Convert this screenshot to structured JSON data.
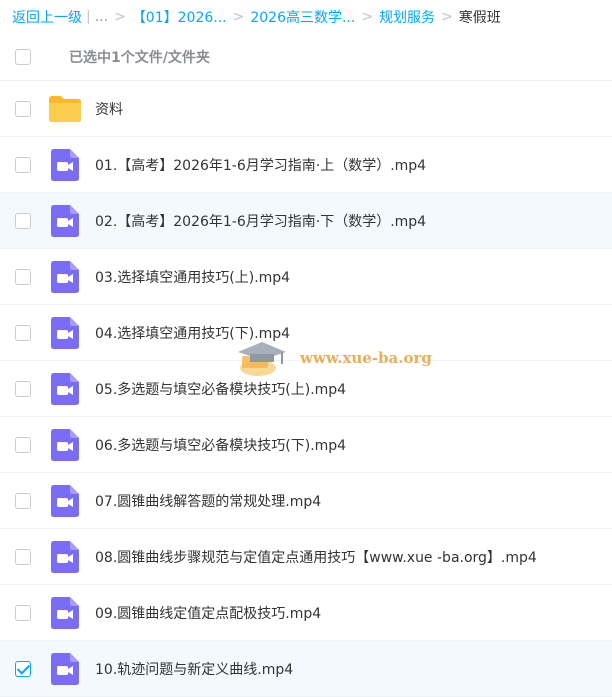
{
  "breadcrumb": {
    "back_label": "返回上一级",
    "ellipsis": "...",
    "crumbs": [
      "【01】2026...",
      "2026高三数学...",
      "规划服务"
    ],
    "current": "寒假班"
  },
  "header": {
    "selected_text": "已选中1个文件/文件夹"
  },
  "files": [
    {
      "name": "资料",
      "type": "folder",
      "checked": false
    },
    {
      "name": "01.【高考】2026年1-6月学习指南·上（数学）.mp4",
      "type": "video",
      "checked": false
    },
    {
      "name": "02.【高考】2026年1-6月学习指南·下（数学）.mp4",
      "type": "video",
      "checked": false
    },
    {
      "name": "03.选择填空通用技巧(上).mp4",
      "type": "video",
      "checked": false
    },
    {
      "name": "04.选择填空通用技巧(下).mp4",
      "type": "video",
      "checked": false
    },
    {
      "name": "05.多选题与填空必备模块技巧(上).mp4",
      "type": "video",
      "checked": false
    },
    {
      "name": "06.多选题与填空必备模块技巧(下).mp4",
      "type": "video",
      "checked": false
    },
    {
      "name": "07.圆锥曲线解答题的常规处理.mp4",
      "type": "video",
      "checked": false
    },
    {
      "name": "08.圆锥曲线步骤规范与定值定点通用技巧【www.xue -ba.org】.mp4",
      "type": "video",
      "checked": false
    },
    {
      "name": "09.圆锥曲线定值定点配极技巧.mp4",
      "type": "video",
      "checked": false
    },
    {
      "name": "10.轨迹问题与新定义曲线.mp4",
      "type": "video",
      "checked": true
    }
  ],
  "watermark": {
    "text": "www.xue-ba.org"
  },
  "colors": {
    "accent": "#06a7ff",
    "video_icon": "#7b6cf6",
    "folder": "#fcc43f",
    "row_highlight": "#f2f9ff"
  }
}
